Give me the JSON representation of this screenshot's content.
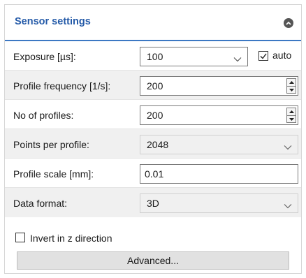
{
  "panel": {
    "title": "Sensor settings",
    "collapse_icon": "chevron-up-circle-icon"
  },
  "exposure": {
    "label": "Exposure [µs]:",
    "value": "100",
    "auto_label": "auto",
    "auto_checked": true
  },
  "profile_frequency": {
    "label": "Profile frequency [1/s]:",
    "value": "200"
  },
  "no_of_profiles": {
    "label": "No of profiles:",
    "value": "200"
  },
  "points_per_profile": {
    "label": "Points per profile:",
    "value": "2048"
  },
  "profile_scale": {
    "label": "Profile scale [mm]:",
    "value": "0.01"
  },
  "data_format": {
    "label": "Data format:",
    "value": "3D"
  },
  "invert": {
    "label": "Invert in z direction",
    "checked": false
  },
  "advanced_button": {
    "label": "Advanced..."
  },
  "colors": {
    "title": "#245aa8",
    "accent_line": "#3c78c3",
    "shaded_row": "#f0f0f0"
  }
}
